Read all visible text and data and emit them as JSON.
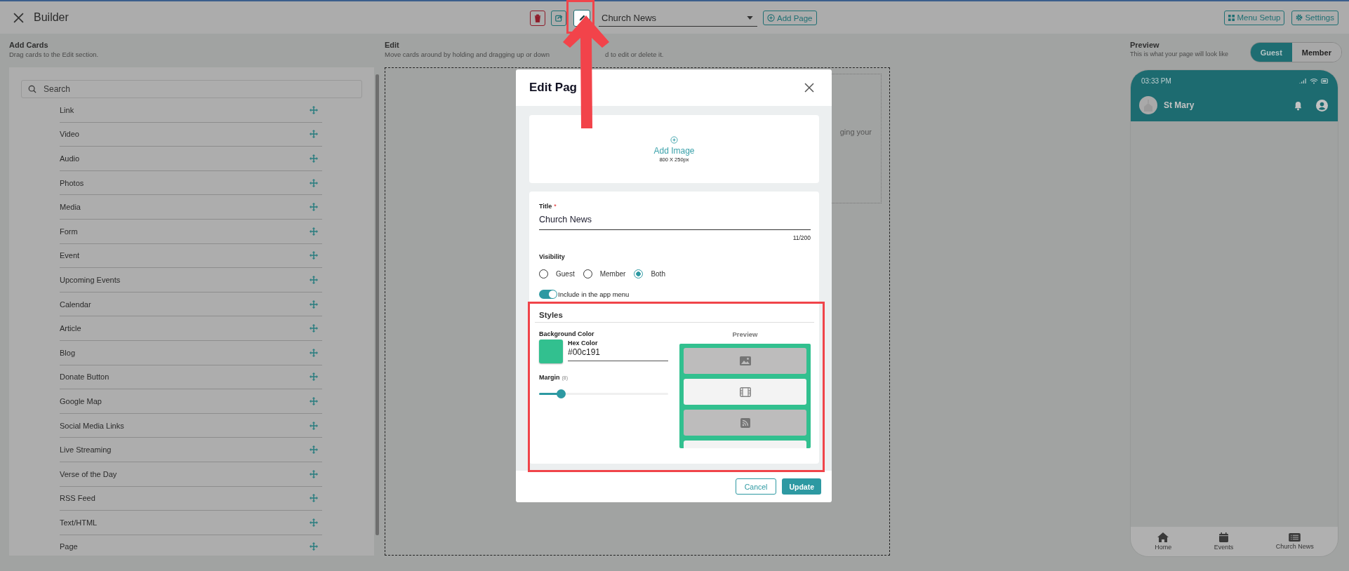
{
  "topbar": {
    "title": "Builder",
    "page_select": "Church News",
    "add_page": "Add Page",
    "menu_setup": "Menu Setup",
    "settings": "Settings"
  },
  "add_cards": {
    "title": "Add Cards",
    "subtitle": "Drag cards to the Edit section.",
    "search_placeholder": "Search",
    "items": [
      "Link",
      "Video",
      "Audio",
      "Photos",
      "Media",
      "Form",
      "Event",
      "Upcoming Events",
      "Calendar",
      "Article",
      "Blog",
      "Donate Button",
      "Google Map",
      "Social Media Links",
      "Live Streaming",
      "Verse of the Day",
      "RSS Feed",
      "Text/HTML",
      "Page"
    ]
  },
  "edit": {
    "title": "Edit",
    "subtitle_start": "Move cards around by holding and dragging up or down",
    "subtitle_end": "d to edit or delete it.",
    "hint_fragment": "ging your"
  },
  "preview": {
    "title": "Preview",
    "subtitle": "This is what your page will look like",
    "modes": [
      {
        "label": "Guest",
        "selected": true
      },
      {
        "label": "Member",
        "selected": false
      }
    ],
    "phone": {
      "time": "03:33 PM",
      "church": "St Mary",
      "nav": [
        {
          "label": "Home",
          "kind": "home"
        },
        {
          "label": "Events",
          "kind": "calendar"
        },
        {
          "label": "Church News",
          "kind": "list"
        }
      ]
    }
  },
  "dialog": {
    "title": "Edit Pag",
    "add_image": "Add Image",
    "image_size": "800 X 250px",
    "title_label": "Title",
    "required_mark": "*",
    "title_value": "Church News",
    "counter": "11/200",
    "visibility_label": "Visibility",
    "visibility": [
      {
        "label": "Guest",
        "selected": false
      },
      {
        "label": "Member",
        "selected": false
      },
      {
        "label": "Both",
        "selected": true
      }
    ],
    "menu_toggle": {
      "label": "Include in the app menu",
      "on": true
    },
    "styles_title": "Styles",
    "bg_color_label": "Background Color",
    "hex_label": "Hex Color",
    "hex_value": "#00c191",
    "margin_label": "Margin",
    "margin_value": "(8)",
    "margin": {
      "level": 0.17
    },
    "preview_label": "Preview",
    "preview_cards": [
      {
        "kind": "image"
      },
      {
        "kind": "video"
      },
      {
        "kind": "rss"
      },
      {
        "kind": "other"
      }
    ],
    "cancel": "Cancel",
    "update": "Update"
  }
}
